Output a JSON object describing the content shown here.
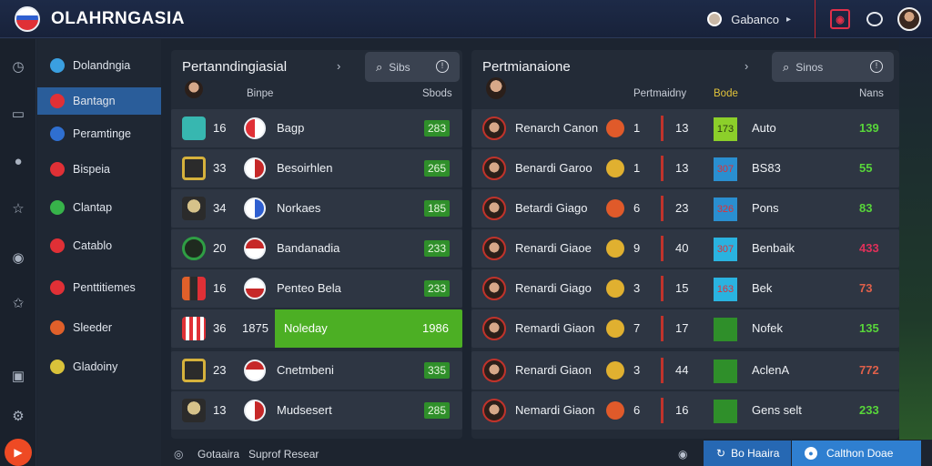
{
  "app": {
    "title": "OLAHRNGASIA"
  },
  "topbar": {
    "user_name": "Gabanco",
    "caret": "▸"
  },
  "sidebar": {
    "items": [
      {
        "label": "Dolandngia",
        "color": "#3a9fe0"
      },
      {
        "label": "Bantagn",
        "color": "#e03036"
      },
      {
        "label": "Peramtinge",
        "color": "#2f6fd0"
      },
      {
        "label": "Bispeia",
        "color": "#e03036"
      },
      {
        "label": "Clantap",
        "color": "#37b34a"
      },
      {
        "label": "Catablo",
        "color": "#e03036"
      },
      {
        "label": "Penttitiemes",
        "color": "#e03036"
      },
      {
        "label": "Sleeder",
        "color": "#e0602a"
      },
      {
        "label": "Gladoiny",
        "color": "#d9c23a"
      }
    ]
  },
  "left_panel": {
    "title": "Pertanndingiasial",
    "search_placeholder": "Sibs",
    "col1": "Binpe",
    "col2": "Sbods",
    "rows": [
      {
        "num": "16",
        "name": "Bagp",
        "score": "283",
        "kit": "#37b7b0",
        "flag_a": "#e03036",
        "flag_b": "#ffffff"
      },
      {
        "num": "33",
        "name": "Besoirhlen",
        "score": "265",
        "kit": "#d6b23c",
        "flag_a": "#ffffff",
        "flag_b": "#c62828"
      },
      {
        "num": "34",
        "name": "Norkaes",
        "score": "185",
        "kit": "#d6c28a",
        "flag_a": "#ffffff",
        "flag_b": "#2f5fd0"
      },
      {
        "num": "20",
        "name": "Bandanadia",
        "score": "233",
        "kit": "#2f9e44",
        "flag_a": "#c62828",
        "flag_b": "#ffffff"
      },
      {
        "num": "16",
        "name": "Penteo Bela",
        "score": "233",
        "kit": "#e0602a",
        "flag_a": "#ffffff",
        "flag_b": "#c62828"
      },
      {
        "num": "36",
        "num2": "1875",
        "name": "Noleday",
        "score": "1986",
        "kit": "#e03036",
        "flag_a": "#e03036",
        "flag_b": "#ffffff",
        "highlight": true
      },
      {
        "num": "23",
        "name": "Cnetmbeni",
        "score": "335",
        "kit": "#d6b23c",
        "flag_a": "#c62828",
        "flag_b": "#ffffff"
      },
      {
        "num": "13",
        "name": "Mudsesert",
        "score": "285",
        "kit": "#d6c28a",
        "flag_a": "#ffffff",
        "flag_b": "#c62828"
      }
    ]
  },
  "right_panel": {
    "title": "Pertmianaione",
    "search_placeholder": "Sinos",
    "col1": "Pertmaidny",
    "col2": "Bode",
    "col3": "Nans",
    "rows": [
      {
        "player": "Renarch Canon",
        "a": "1",
        "b": "13",
        "badge": "173",
        "badge_bg": "#8ccf2a",
        "badge_fg": "#2a3a10",
        "name": "Auto",
        "val": "139",
        "val_color": "#58d63a",
        "dot": "#e05a2a"
      },
      {
        "player": "Benardi Garoo",
        "a": "1",
        "b": "13",
        "badge": "307",
        "badge_bg": "#2a8fd0",
        "badge_fg": "#e03036",
        "name": "BS83",
        "val": "55",
        "val_color": "#58d63a",
        "dot": "#e0b030"
      },
      {
        "player": "Betardi Giago",
        "a": "6",
        "b": "23",
        "badge": "326",
        "badge_bg": "#2a8fd0",
        "badge_fg": "#e03036",
        "name": "Pons",
        "val": "83",
        "val_color": "#58d63a",
        "dot": "#e05a2a"
      },
      {
        "player": "Renardi Giaoe",
        "a": "9",
        "b": "40",
        "badge": "307",
        "badge_bg": "#2ab3e0",
        "badge_fg": "#e03036",
        "name": "Benbaik",
        "val": "433",
        "val_color": "#e0305a",
        "dot": "#e0b030"
      },
      {
        "player": "Renardi Giago",
        "a": "3",
        "b": "15",
        "badge": "163",
        "badge_bg": "#2ab3e0",
        "badge_fg": "#e03036",
        "name": "Bek",
        "val": "73",
        "val_color": "#e0604a",
        "dot": "#e0b030"
      },
      {
        "player": "Remardi Giaon",
        "a": "7",
        "b": "17",
        "badge": "",
        "badge_bg": "#2f8f2a",
        "badge_fg": "#e03036",
        "name": "Nofek",
        "val": "135",
        "val_color": "#58d63a",
        "dot": "#e0b030"
      },
      {
        "player": "Renardi Giaon",
        "a": "3",
        "b": "44",
        "badge": "",
        "badge_bg": "#2f8f2a",
        "badge_fg": "#e03036",
        "name": "AclenA",
        "val": "772",
        "val_color": "#e0604a",
        "dot": "#e0b030"
      },
      {
        "player": "Nemardi Giaon",
        "a": "6",
        "b": "16",
        "badge": "",
        "badge_bg": "#2f8f2a",
        "badge_fg": "#e03036",
        "name": "Gens selt",
        "val": "233",
        "val_color": "#58d63a",
        "dot": "#e05a2a"
      }
    ]
  },
  "footer": {
    "left_label": "Gotaaira",
    "left_value": "Suprof Resear",
    "btn1": "Bo Haaira",
    "btn2": "Calthon Doae"
  }
}
